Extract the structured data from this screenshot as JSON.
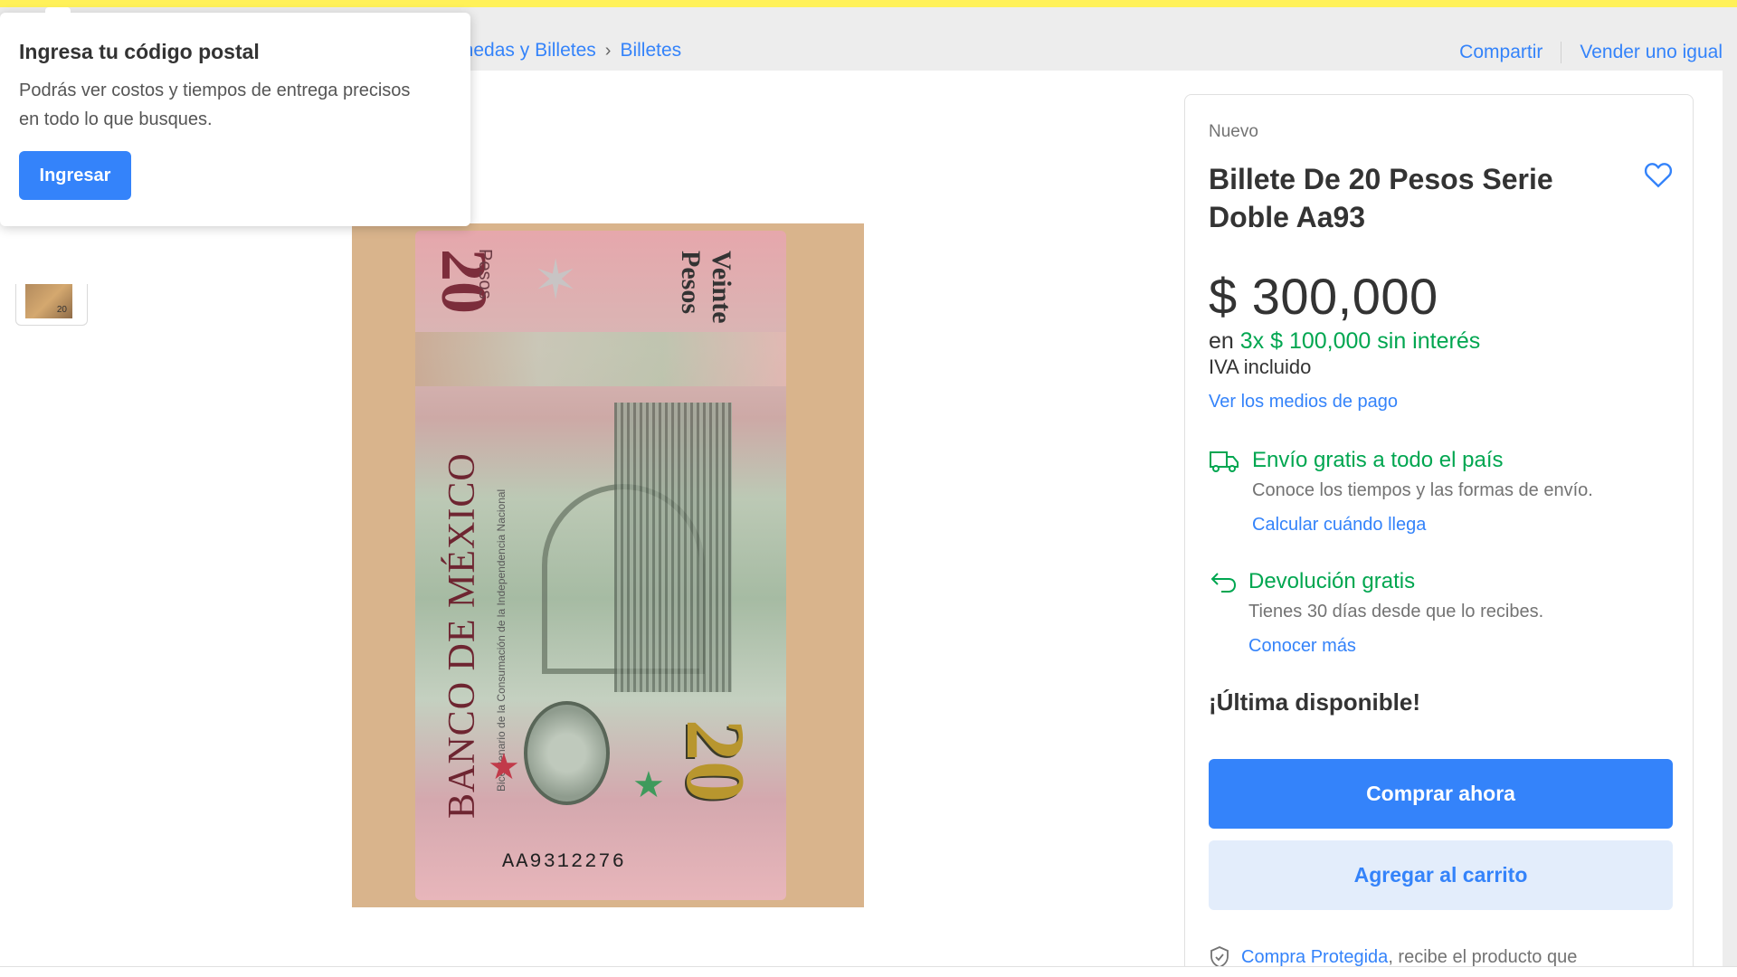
{
  "breadcrumb": {
    "items": [
      "onedas y Billetes",
      "Billetes"
    ]
  },
  "header_actions": {
    "share": "Compartir",
    "sell_similar": "Vender uno igual"
  },
  "popover": {
    "title": "Ingresa tu código postal",
    "text": "Podrás ver costos y tiempos de entrega precisos en todo lo que busques.",
    "button": "Ingresar"
  },
  "gallery": {
    "thumb_label": "20",
    "image": {
      "top_denomination": "20",
      "pesos_word": "Pesos",
      "veinte": "Veinte Pesos",
      "bank": "BANCO DE MÉXICO",
      "bicentenario": "Bicentenario de la Consumación de la Independencia Nacional",
      "gold_denomination": "20",
      "serial": "AA9312276"
    }
  },
  "product": {
    "condition": "Nuevo",
    "title": "Billete De 20 Pesos Serie Doble Aa93",
    "price": "$ 300,000",
    "installments_prefix": "en ",
    "installments": "3x $ 100,000 sin interés",
    "tax": "IVA incluido",
    "payment_link": "Ver los medios de pago",
    "shipping": {
      "title": "Envío gratis a todo el país",
      "subtitle": "Conoce los tiempos y las formas de envío.",
      "link": "Calcular cuándo llega"
    },
    "returns": {
      "title": "Devolución gratis",
      "subtitle": "Tienes 30 días desde que lo recibes.",
      "link": "Conocer más"
    },
    "stock": "¡Última disponible!",
    "buy_now": "Comprar ahora",
    "add_to_cart": "Agregar al carrito",
    "protection_link": "Compra Protegida",
    "protection_text": ", recibe el producto que"
  },
  "colors": {
    "accent": "#3483fa",
    "success": "#00a650",
    "header_yellow": "#fff159"
  }
}
